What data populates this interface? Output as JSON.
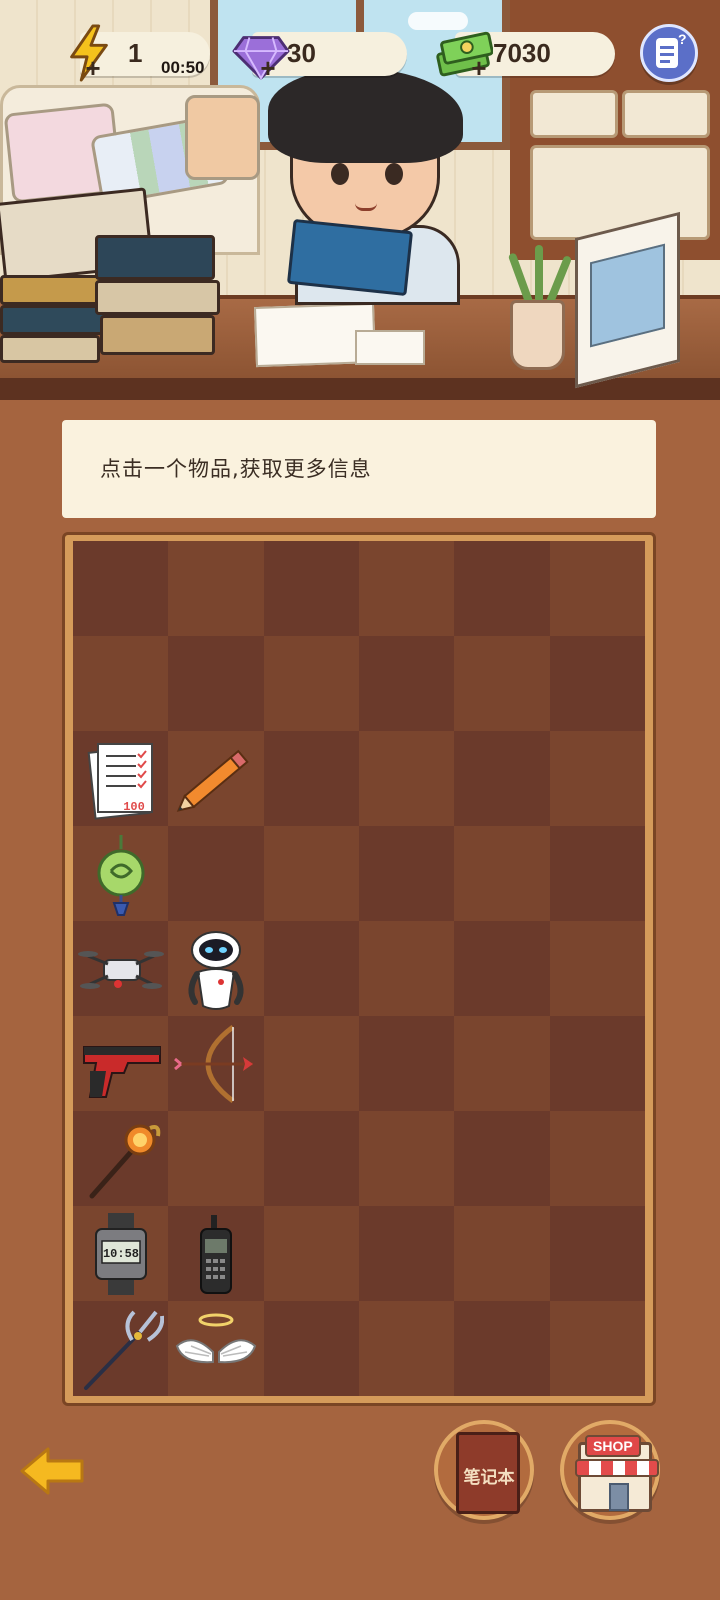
{
  "hud": {
    "energy": {
      "value": "1",
      "timer": "00:50",
      "icon": "lightning-icon"
    },
    "gems": {
      "value": "30",
      "icon": "gem-icon"
    },
    "cash": {
      "value": "7030",
      "icon": "cash-icon"
    },
    "help_icon": "help-notes-icon"
  },
  "banner": {
    "text": "点击一个物品,获取更多信息"
  },
  "grid": {
    "columns": 6,
    "rows": 9,
    "items": [
      {
        "row": 3,
        "col": 1,
        "icon": "test-paper-icon",
        "label": "100"
      },
      {
        "row": 3,
        "col": 2,
        "icon": "pencil-icon"
      },
      {
        "row": 4,
        "col": 1,
        "icon": "jade-pendant-icon"
      },
      {
        "row": 5,
        "col": 1,
        "icon": "drone-icon"
      },
      {
        "row": 5,
        "col": 2,
        "icon": "robot-icon"
      },
      {
        "row": 6,
        "col": 1,
        "icon": "pistol-icon"
      },
      {
        "row": 6,
        "col": 2,
        "icon": "cupid-bow-icon"
      },
      {
        "row": 7,
        "col": 1,
        "icon": "magic-staff-icon"
      },
      {
        "row": 8,
        "col": 1,
        "icon": "digital-watch-icon",
        "label": "10:58"
      },
      {
        "row": 8,
        "col": 2,
        "icon": "brick-phone-icon"
      },
      {
        "row": 9,
        "col": 1,
        "icon": "trident-icon"
      },
      {
        "row": 9,
        "col": 2,
        "icon": "angel-wings-icon"
      }
    ]
  },
  "buttons": {
    "back_icon": "back-arrow-icon",
    "notebook_label": "笔记本",
    "shop_label": "SHOP"
  },
  "colors": {
    "background": "#a5643f",
    "cell_dark": "#6b3a2b",
    "cell_light": "#7a452e",
    "banner": "#faf2de",
    "accent_yellow": "#f5b920"
  }
}
